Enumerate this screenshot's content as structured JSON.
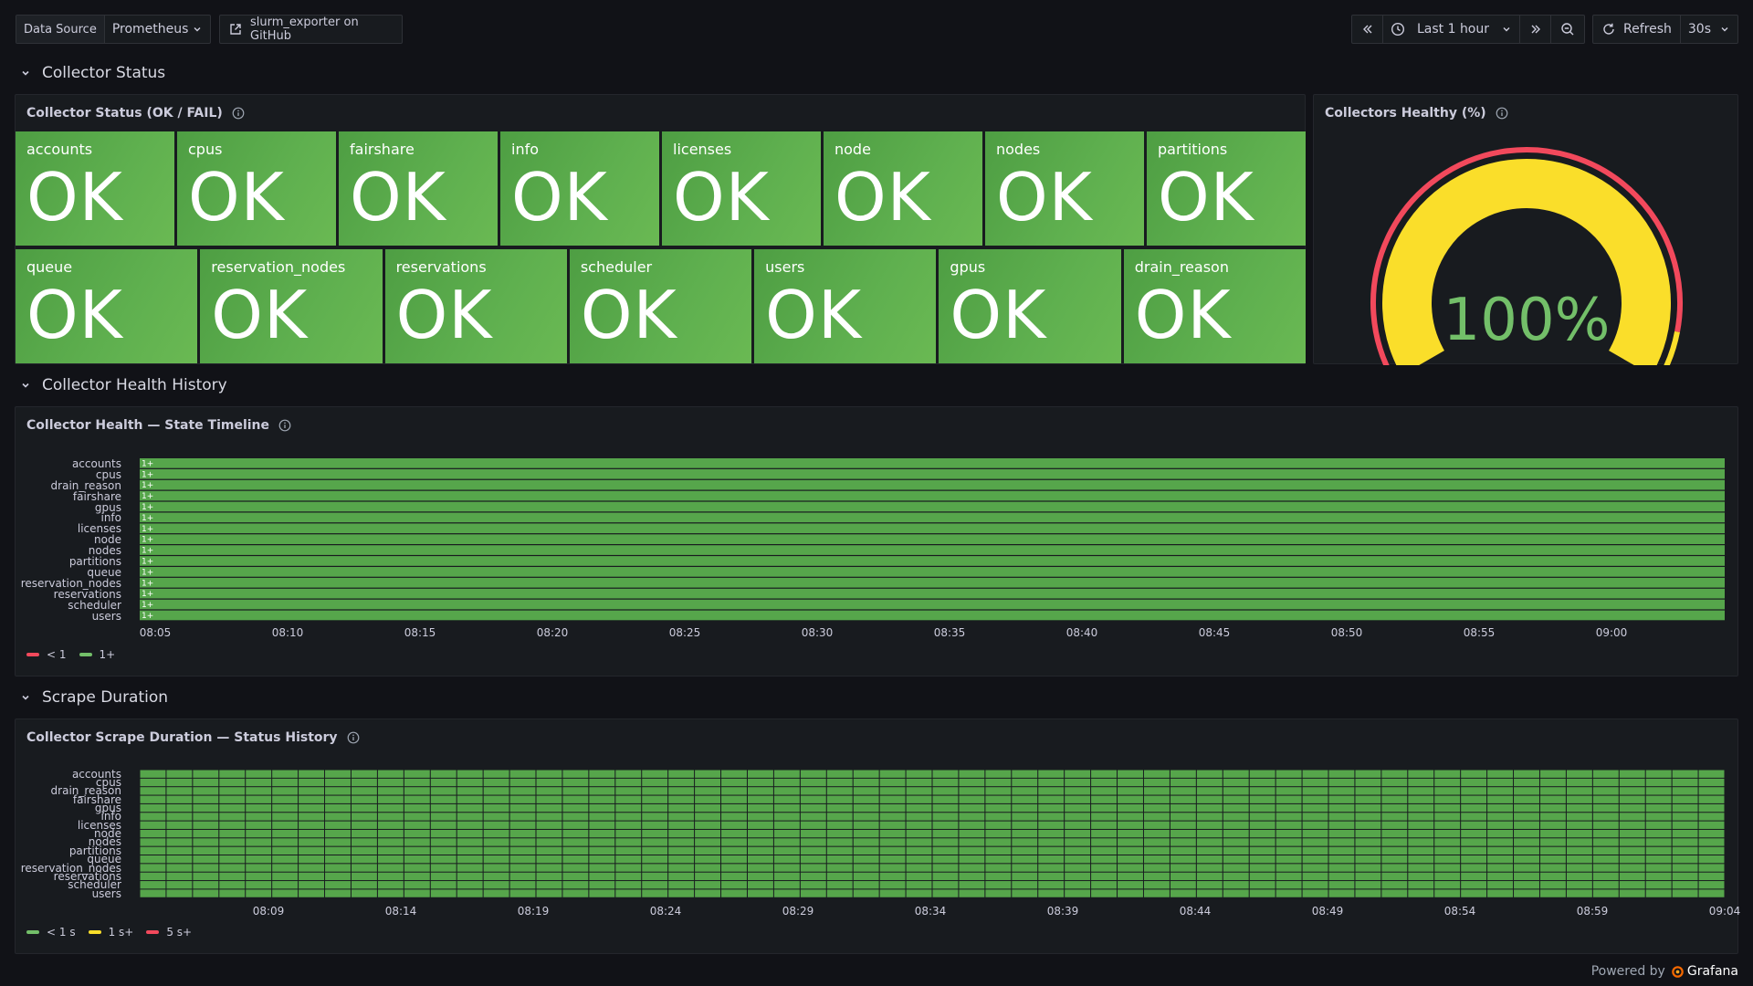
{
  "toolbar": {
    "datasource_label": "Data Source",
    "datasource_value": "Prometheus",
    "github_link": "slurm_exporter on GitHub",
    "time_range": "Last 1 hour",
    "refresh_label": "Refresh",
    "refresh_interval": "30s"
  },
  "rows": {
    "status": "Collector Status",
    "history": "Collector Health History",
    "scrape": "Scrape Duration"
  },
  "status_panel": {
    "title": "Collector Status (OK / FAIL)",
    "row1": [
      {
        "name": "accounts",
        "value": "OK"
      },
      {
        "name": "cpus",
        "value": "OK"
      },
      {
        "name": "fairshare",
        "value": "OK"
      },
      {
        "name": "info",
        "value": "OK"
      },
      {
        "name": "licenses",
        "value": "OK"
      },
      {
        "name": "node",
        "value": "OK"
      },
      {
        "name": "nodes",
        "value": "OK"
      },
      {
        "name": "partitions",
        "value": "OK"
      }
    ],
    "row2": [
      {
        "name": "queue",
        "value": "OK"
      },
      {
        "name": "reservation_nodes",
        "value": "OK"
      },
      {
        "name": "reservations",
        "value": "OK"
      },
      {
        "name": "scheduler",
        "value": "OK"
      },
      {
        "name": "users",
        "value": "OK"
      },
      {
        "name": "gpus",
        "value": "OK"
      },
      {
        "name": "drain_reason",
        "value": "OK"
      }
    ],
    "ok_color": "#56a64b"
  },
  "gauge_panel": {
    "title": "Collectors Healthy (%)",
    "value_text": "100%",
    "value": 100,
    "value_color": "#73bf69",
    "fill_color": "#fade2a",
    "threshold_colors": [
      "#f2495c",
      "#fade2a"
    ]
  },
  "timeline_panel": {
    "title": "Collector Health — State Timeline",
    "rows": [
      "accounts",
      "cpus",
      "drain_reason",
      "fairshare",
      "gpus",
      "info",
      "licenses",
      "node",
      "nodes",
      "partitions",
      "queue",
      "reservation_nodes",
      "reservations",
      "scheduler",
      "users"
    ],
    "state_text": "1+",
    "ticks": [
      "08:05",
      "08:10",
      "08:15",
      "08:20",
      "08:25",
      "08:30",
      "08:35",
      "08:40",
      "08:45",
      "08:50",
      "08:55",
      "09:00"
    ],
    "legend": [
      {
        "label": "< 1",
        "color": "#f2495c"
      },
      {
        "label": "1+",
        "color": "#73bf69"
      }
    ],
    "bar_color": "#56a64b"
  },
  "history_panel": {
    "title": "Collector Scrape Duration — Status History",
    "rows": [
      "accounts",
      "cpus",
      "drain_reason",
      "fairshare",
      "gpus",
      "info",
      "licenses",
      "node",
      "nodes",
      "partitions",
      "queue",
      "reservation_nodes",
      "reservations",
      "scheduler",
      "users"
    ],
    "columns": 60,
    "ticks": [
      "08:09",
      "08:14",
      "08:19",
      "08:24",
      "08:29",
      "08:34",
      "08:39",
      "08:44",
      "08:49",
      "08:54",
      "08:59",
      "09:04"
    ],
    "legend": [
      {
        "label": "< 1 s",
        "color": "#73bf69"
      },
      {
        "label": "1 s+",
        "color": "#fade2a"
      },
      {
        "label": "5 s+",
        "color": "#f2495c"
      }
    ],
    "cell_color": "#56a64b"
  },
  "footer": {
    "powered_by": "Powered by",
    "brand": "Grafana"
  }
}
